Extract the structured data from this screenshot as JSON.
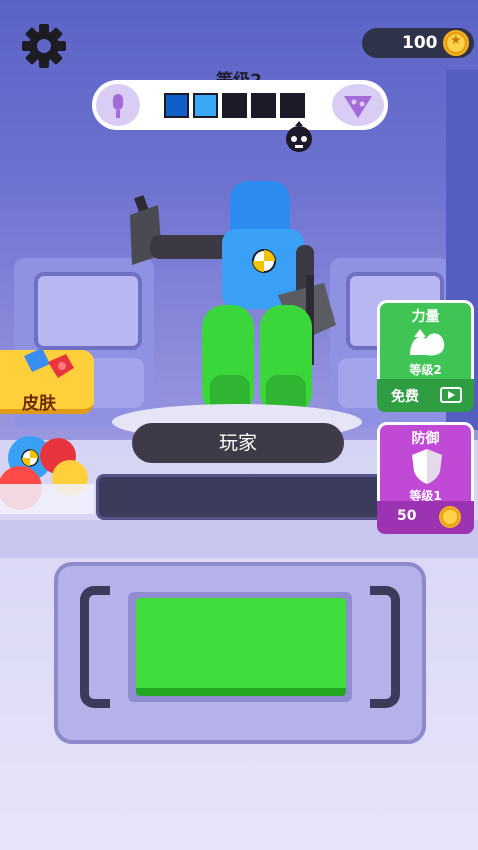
{
  "hud": {
    "coins": "100",
    "level_label": "等级2",
    "level_segments": [
      "filled-dark",
      "filled-light",
      "empty",
      "empty",
      "empty"
    ]
  },
  "character": {
    "name": "玩家"
  },
  "left_menu": {
    "skin_label": "皮肤"
  },
  "upgrades": {
    "power": {
      "title": "力量",
      "level": "等级2",
      "cost_label": "免费"
    },
    "defense": {
      "title": "防御",
      "level": "等级1",
      "price": "50"
    }
  },
  "colors": {
    "power_card": "#3fc455",
    "defense_card": "#c04ad6",
    "action_button": "#3fdc3c",
    "skin_button": "#ffcf3c"
  },
  "icons": [
    "gear-icon",
    "coin-icon",
    "microphone-icon",
    "pizza-icon",
    "skull-icon",
    "muscle-icon",
    "video-ad-icon",
    "shield-icon"
  ]
}
